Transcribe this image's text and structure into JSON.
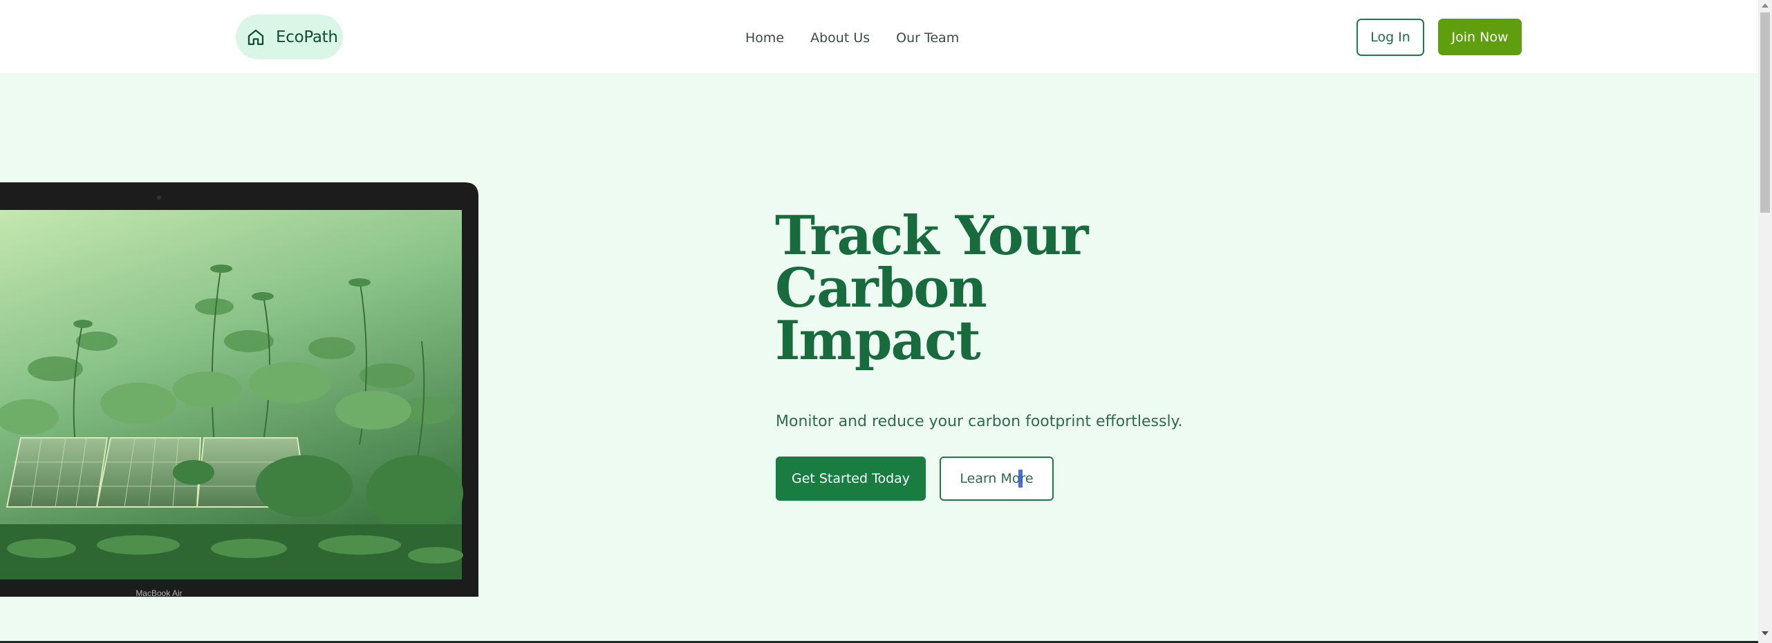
{
  "header": {
    "brand": {
      "name": "EcoPath",
      "icon": "home-icon"
    },
    "nav": [
      {
        "label": "Home"
      },
      {
        "label": "About Us"
      },
      {
        "label": "Our Team"
      }
    ],
    "login_label": "Log In",
    "join_label": "Join Now"
  },
  "hero": {
    "title_line1": "Track Your Carbon",
    "title_line2": "Impact",
    "subtitle": "Monitor and reduce your carbon footprint effortlessly.",
    "primary_cta": "Get Started Today",
    "secondary_cta": "Learn More",
    "image": {
      "subject": "laptop showing solar panels surrounded by green plants",
      "device_label": "MacBook Air"
    }
  },
  "colors": {
    "brand_green": "#186b3c",
    "primary_button": "#197c40",
    "join_button": "#5e9e0f",
    "hero_background": "#edfbf3",
    "brand_pill": "#d9f6e6"
  }
}
